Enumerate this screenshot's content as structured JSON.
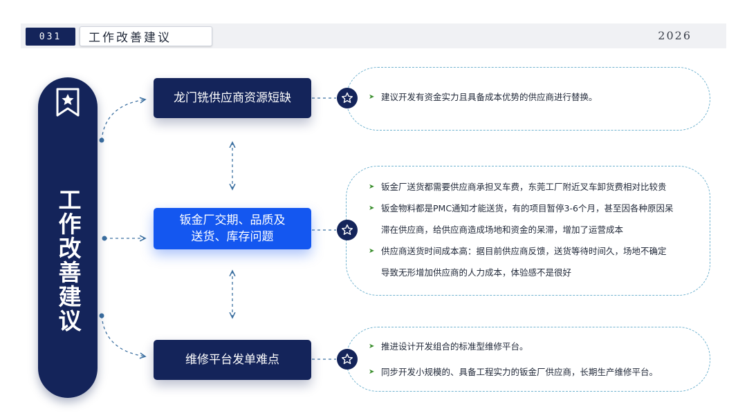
{
  "header": {
    "page_number": "031",
    "title": "工作改善建议",
    "year": "2026"
  },
  "sidebar": {
    "title": "工作改善建议",
    "badge_icon": "star-bookmark-icon"
  },
  "issues": [
    {
      "label": "龙门铣供应商资源短缺"
    },
    {
      "line1": "钣金厂交期、品质及",
      "line2": "送货、库存问题"
    },
    {
      "label": "维修平台发单难点"
    }
  ],
  "suggestions": [
    {
      "items": [
        {
          "text": "建议开发有资金实力且具备成本优势的供应商进行替换。"
        }
      ]
    },
    {
      "items": [
        {
          "text": "钣金厂送货都需要供应商承担叉车费，东莞工厂附近叉车卸货费相对比较贵"
        },
        {
          "text": "钣金物料都是PMC通知才能送货，有的项目暂停3-6个月，甚至因各种原因呆",
          "cont": "滞在供应商，给供应商造成场地和资金的呆滞，增加了运营成本"
        },
        {
          "text": "供应商送货时间成本高：据目前供应商反馈，送货等待时间久，场地不确定",
          "cont": "导致无形增加供应商的人力成本，体验感不是很好"
        }
      ]
    },
    {
      "items": [
        {
          "text": "推进设计开发组合的标准型维修平台。"
        },
        {
          "text": "同步开发小规模的、具备工程实力的钣金厂供应商，长期生产维修平台。"
        }
      ]
    }
  ],
  "colors": {
    "navy": "#14245a",
    "blue_accent": "#1457f0",
    "dashed_border": "#6fb2cf",
    "arrow_green": "#3b8f2e"
  }
}
